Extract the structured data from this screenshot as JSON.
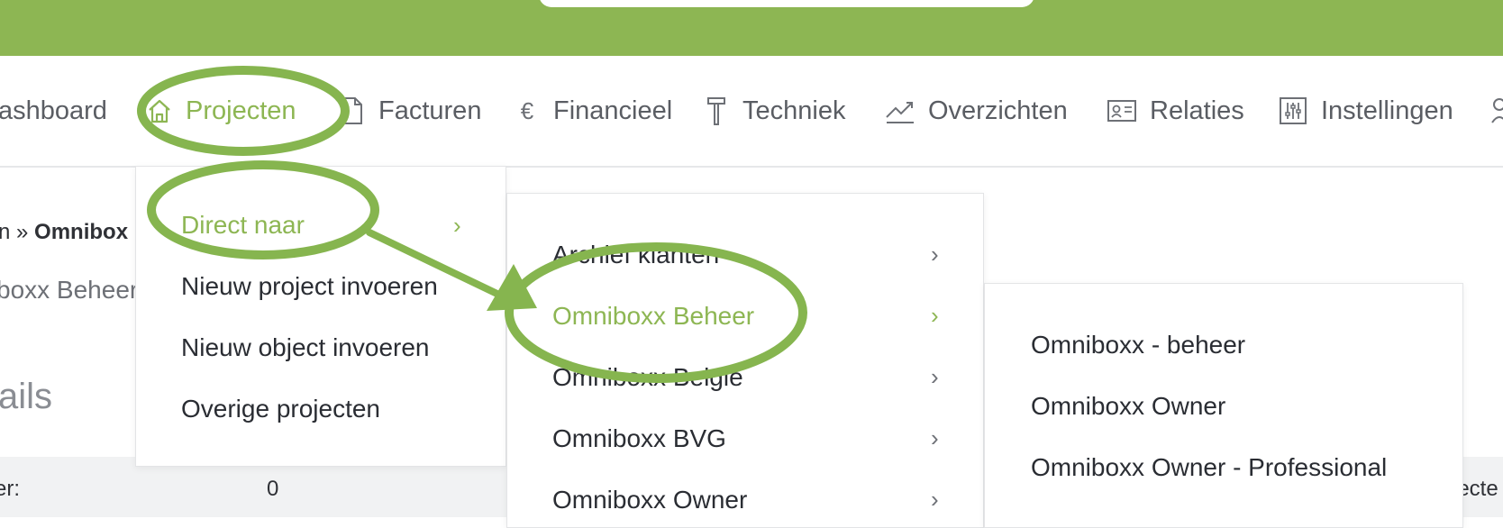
{
  "nav": {
    "items": [
      {
        "label": "ashboard",
        "icon": ""
      },
      {
        "label": "Projecten",
        "icon": "home-icon"
      },
      {
        "label": "Facturen",
        "icon": "document-icon"
      },
      {
        "label": "Financieel",
        "icon": "euro-icon"
      },
      {
        "label": "Techniek",
        "icon": "hammer-icon"
      },
      {
        "label": "Overzichten",
        "icon": "chart-line-icon"
      },
      {
        "label": "Relaties",
        "icon": "contact-card-icon"
      },
      {
        "label": "Instellingen",
        "icon": "sliders-icon"
      }
    ],
    "euro_glyph": "€"
  },
  "page": {
    "breadcrumb_prefix": "n » ",
    "breadcrumb_current": "Omnibox",
    "subtitle": "boxx Beheer",
    "section_title": "ails",
    "detail_label": "er:",
    "detail_value": "0",
    "detail_right": "jecte"
  },
  "menu1": {
    "items": [
      "Direct naar",
      "Nieuw project invoeren",
      "Nieuw object invoeren",
      "Overige projecten"
    ]
  },
  "menu2": {
    "items": [
      "Archief klanten",
      "Omniboxx Beheer",
      "Omniboxx Belgie",
      "Omniboxx BVG",
      "Omniboxx Owner"
    ]
  },
  "menu3": {
    "items": [
      "Omniboxx - beheer",
      "Omniboxx Owner",
      "Omniboxx Owner - Professional"
    ]
  },
  "colors": {
    "accent": "#8db653",
    "topbar": "#8db653",
    "annotation": "#86b54f"
  }
}
